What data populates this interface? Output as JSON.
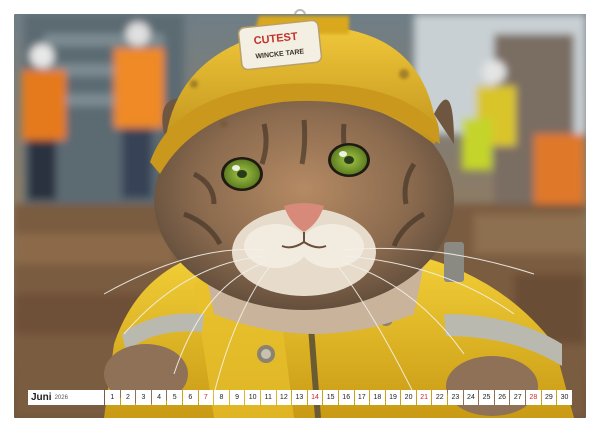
{
  "calendar": {
    "month": "Juni",
    "year": "2026",
    "days": [
      "1",
      "2",
      "3",
      "4",
      "5",
      "6",
      "7",
      "8",
      "9",
      "10",
      "11",
      "12",
      "13",
      "14",
      "15",
      "16",
      "17",
      "18",
      "19",
      "20",
      "21",
      "22",
      "23",
      "24",
      "25",
      "26",
      "27",
      "28",
      "29",
      "30"
    ],
    "sundays": [
      "7",
      "14",
      "21",
      "28"
    ],
    "accent_color": "#d0252b"
  },
  "photo": {
    "helmet_badge_line1": "CUTEST",
    "helmet_badge_line2": "WINCKE TARE"
  },
  "colors": {
    "helmet": "#e2b52a",
    "jacket": "#f1c92a",
    "reflective": "#b9b9b0"
  }
}
